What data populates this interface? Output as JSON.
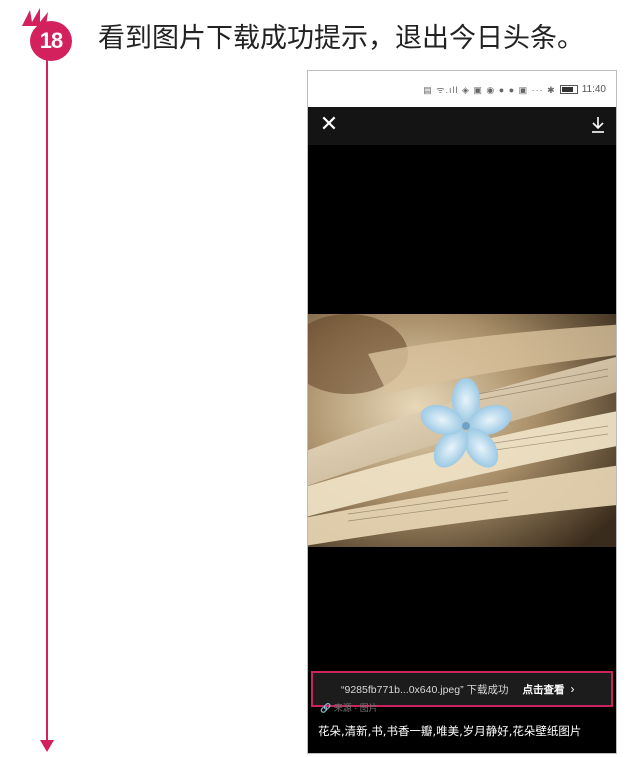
{
  "step": {
    "number": "18",
    "title": "看到图片下载成功提示，退出今日头条。"
  },
  "phone": {
    "status_bar": {
      "icons": "▤ ᯤ.ıll ◈ ▣ ◉ ● ● ▣ ···  ✱",
      "time": "11:40"
    },
    "topbar": {
      "close_icon": "close-icon",
      "download_icon": "download-icon"
    },
    "toast": {
      "message": "“9285fb771b...0x640.jpeg” 下载成功",
      "action": "点击查看",
      "chevron": "›"
    },
    "source_line": "🔗 来源 · 图片",
    "caption": "花朵,清新,书,书香一瓣,唯美,岁月静好,花朵壁纸图片"
  },
  "colors": {
    "accent": "#d2215d",
    "toast_border": "#c9245f"
  }
}
